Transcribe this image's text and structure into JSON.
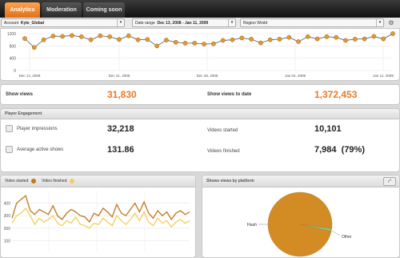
{
  "tabs": [
    {
      "label": "Analytics",
      "active": true
    },
    {
      "label": "Moderation",
      "active": false
    },
    {
      "label": "Coming soon",
      "active": false
    }
  ],
  "filters": {
    "account_label": "Account",
    "account_value": "Kyte_Global",
    "date_label": "Date range",
    "date_value": "Dec 13, 2008 - Jan 11, 2009",
    "region_value": "Region World"
  },
  "views_chart": {
    "type": "line",
    "y_ticks": [
      "1200",
      "800",
      "400",
      "0"
    ],
    "ylim": [
      0,
      1200
    ],
    "x_labels": [
      "Dec 14, 2008",
      "Dec 21, 2008",
      "Dec 28, 2008",
      "Jan 04, 2009",
      "Jan 11, 2009"
    ],
    "color": "#e39a2d"
  },
  "chart_data": [
    {
      "type": "line",
      "x_labels": [
        "Dec 14, 2008",
        "Dec 21, 2008",
        "Dec 28, 2008",
        "Jan 04, 2009",
        "Jan 11, 2009"
      ],
      "y_ticks": [
        1200,
        800,
        400,
        0
      ],
      "ylim": [
        0,
        1200
      ],
      "series": [
        {
          "values": [
            1040,
            750,
            1000,
            1120,
            1110,
            1140,
            1100,
            1000,
            1130,
            1100,
            1010,
            1130,
            1000,
            1010,
            800,
            990,
            920,
            890,
            890,
            860,
            870,
            980,
            1000,
            1060,
            1020,
            900,
            1000,
            1020,
            1080,
            940,
            1100,
            1030,
            1100,
            1080,
            980,
            1020,
            1030,
            1110,
            1030,
            1200
          ]
        }
      ]
    },
    {
      "type": "line",
      "ylim": [
        0,
        500
      ],
      "y_ticks": [
        400,
        300,
        200,
        100
      ],
      "series": [
        {
          "name": "Video started",
          "color": "#c0771a",
          "values": [
            280,
            400,
            430,
            460,
            340,
            310,
            350,
            330,
            310,
            380,
            300,
            270,
            320,
            350,
            330,
            300,
            290,
            250,
            320,
            300,
            360,
            330,
            290,
            390,
            320,
            300,
            350,
            400,
            330,
            410,
            320,
            280,
            340,
            300,
            330,
            270,
            320,
            340,
            310,
            330
          ]
        },
        {
          "name": "Video finished",
          "color": "#f0cf5a",
          "values": [
            240,
            300,
            320,
            360,
            300,
            230,
            280,
            250,
            270,
            300,
            240,
            220,
            260,
            240,
            290,
            230,
            220,
            200,
            240,
            230,
            280,
            250,
            220,
            300,
            260,
            230,
            270,
            320,
            260,
            330,
            250,
            220,
            280,
            240,
            260,
            210,
            250,
            270,
            240,
            260
          ]
        }
      ]
    },
    {
      "type": "pie",
      "title": "Shows views by platform",
      "slices": [
        {
          "label": "Flash",
          "value": 98.6,
          "color": "#d38b24"
        },
        {
          "label": "Other",
          "value": 1.4,
          "color": "#8fbf82"
        }
      ]
    }
  ],
  "show_views": {
    "label": "Show views",
    "value": "31,830",
    "to_date_label": "Show views to date",
    "to_date_value": "1,372,453"
  },
  "engagement": {
    "title": "Player Engagement",
    "impressions_label": "Player impressions",
    "impressions_value": "32,218",
    "active_label": "Average active shows",
    "active_value": "131.86",
    "started_label": "Videos started",
    "started_value": "10,101",
    "finished_label": "Videos finished",
    "finished_value": "7,984",
    "finished_pct": "(79%)"
  },
  "video_chart": {
    "legend_started": "Video started",
    "legend_finished": "Video finished",
    "y_ticks": [
      "400",
      "300",
      "200",
      "100"
    ]
  },
  "platform_chart": {
    "title": "Shows views by platform",
    "flash_label": "Flash",
    "other_label": "Other"
  }
}
